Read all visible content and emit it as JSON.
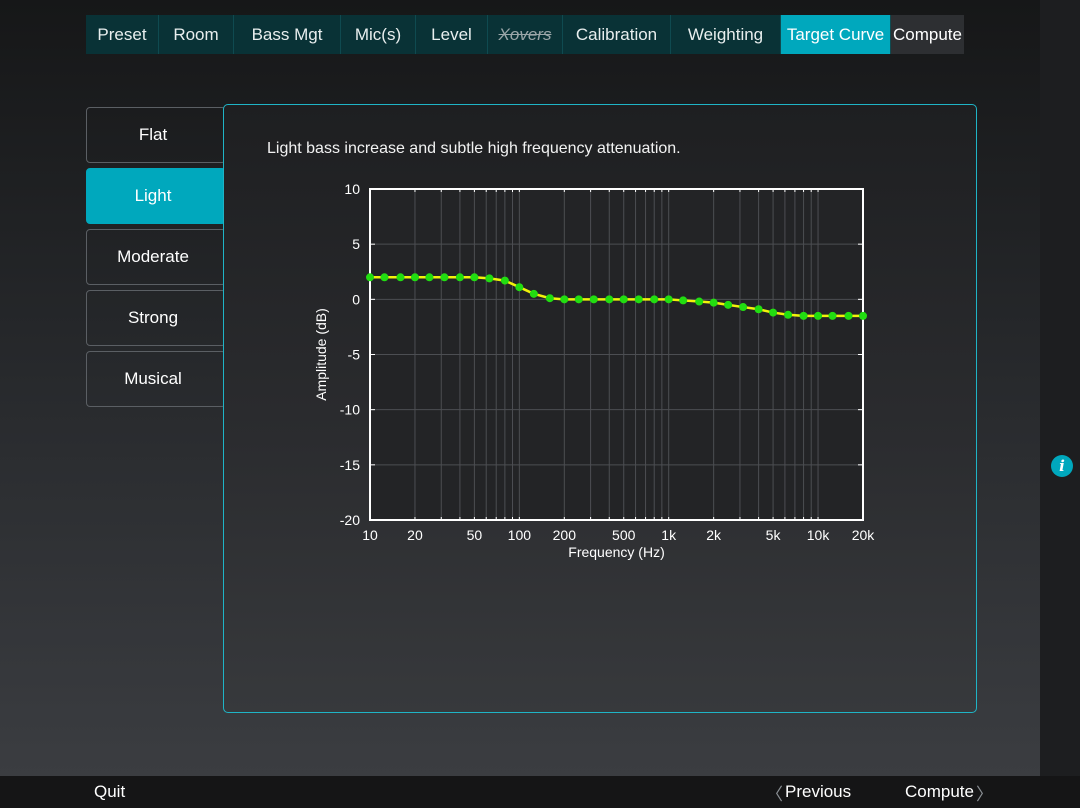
{
  "tabs": [
    {
      "label": "Preset",
      "state": "normal"
    },
    {
      "label": "Room",
      "state": "normal"
    },
    {
      "label": "Bass Mgt",
      "state": "normal"
    },
    {
      "label": "Mic(s)",
      "state": "normal"
    },
    {
      "label": "Level",
      "state": "normal"
    },
    {
      "label": "Xovers",
      "state": "disabled"
    },
    {
      "label": "Calibration",
      "state": "normal"
    },
    {
      "label": "Weighting",
      "state": "normal"
    },
    {
      "label": "Target Curve",
      "state": "active"
    },
    {
      "label": "Compute",
      "state": "compute"
    }
  ],
  "options": [
    {
      "label": "Flat",
      "selected": false
    },
    {
      "label": "Light",
      "selected": true
    },
    {
      "label": "Moderate",
      "selected": false
    },
    {
      "label": "Strong",
      "selected": false
    },
    {
      "label": "Musical",
      "selected": false
    }
  ],
  "description": "Light bass increase and subtle high frequency attenuation.",
  "chart_data": {
    "type": "line",
    "xlabel": "Frequency (Hz)",
    "ylabel": "Amplitude (dB)",
    "xscale": "log",
    "xlim": [
      10,
      20000
    ],
    "ylim": [
      -20,
      10
    ],
    "xticks": [
      10,
      20,
      50,
      100,
      200,
      500,
      1000,
      2000,
      5000,
      10000,
      20000
    ],
    "xtick_labels": [
      "10",
      "20",
      "50",
      "100",
      "200",
      "500",
      "1k",
      "2k",
      "5k",
      "10k",
      "20k"
    ],
    "yticks": [
      10,
      5,
      0,
      -5,
      -10,
      -15,
      -20
    ],
    "ytick_labels": [
      "10",
      "5",
      "0",
      "-5",
      "-10",
      "-15",
      "-20"
    ],
    "grid": true,
    "line_color": "#f2f20a",
    "marker_color": "#22dd11",
    "series": [
      {
        "x": [
          10,
          12.5,
          16,
          20,
          25,
          31.5,
          40,
          50,
          63,
          80,
          100,
          125,
          160,
          200,
          250,
          315,
          400,
          500,
          630,
          800,
          1000,
          1250,
          1600,
          2000,
          2500,
          3150,
          4000,
          5000,
          6300,
          8000,
          10000,
          12500,
          16000,
          20000
        ],
        "y": [
          2,
          2,
          2,
          2,
          2,
          2,
          2,
          2,
          1.9,
          1.7,
          1.1,
          0.5,
          0.1,
          0,
          0,
          0,
          0,
          0,
          0,
          0,
          0,
          -0.1,
          -0.2,
          -0.3,
          -0.5,
          -0.7,
          -0.9,
          -1.2,
          -1.4,
          -1.5,
          -1.5,
          -1.5,
          -1.5,
          -1.5
        ]
      }
    ]
  },
  "bottom": {
    "quit": "Quit",
    "previous": "Previous",
    "compute": "Compute",
    "prev_chevron": "〈",
    "next_chevron": "〉"
  },
  "info_icon": "i",
  "colors": {
    "accent": "#00a8bd",
    "tab_bg": "#093236",
    "line": "#f2f20a",
    "markers": "#22dd11"
  }
}
